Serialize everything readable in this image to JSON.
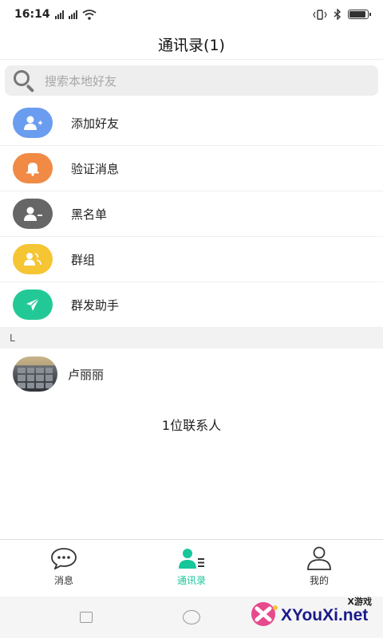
{
  "status_bar": {
    "time": "16:14",
    "battery_level": 0.85
  },
  "header": {
    "title": "通讯录(1)"
  },
  "search": {
    "placeholder": "搜索本地好友"
  },
  "menu": {
    "items": [
      {
        "label": "添加好友",
        "icon": "add-user-icon",
        "color": "#6a9cf0"
      },
      {
        "label": "验证消息",
        "icon": "bell-icon",
        "color": "#f08a45"
      },
      {
        "label": "黑名单",
        "icon": "remove-user-icon",
        "color": "#666666"
      },
      {
        "label": "群组",
        "icon": "group-icon",
        "color": "#f6c534"
      },
      {
        "label": "群发助手",
        "icon": "send-icon",
        "color": "#22c996"
      }
    ]
  },
  "contacts": {
    "section_letter": "L",
    "list": [
      {
        "name": "卢丽丽"
      }
    ],
    "count_text": "1位联系人"
  },
  "tabbar": {
    "tabs": [
      {
        "label": "消息",
        "icon": "chat-bubble-icon",
        "active": false
      },
      {
        "label": "通讯录",
        "icon": "contacts-icon",
        "active": true
      },
      {
        "label": "我的",
        "icon": "profile-icon",
        "active": false
      }
    ],
    "active_color": "#17c69a"
  },
  "watermark": {
    "brand": "XYouXi.net",
    "tag": "X游戏"
  }
}
